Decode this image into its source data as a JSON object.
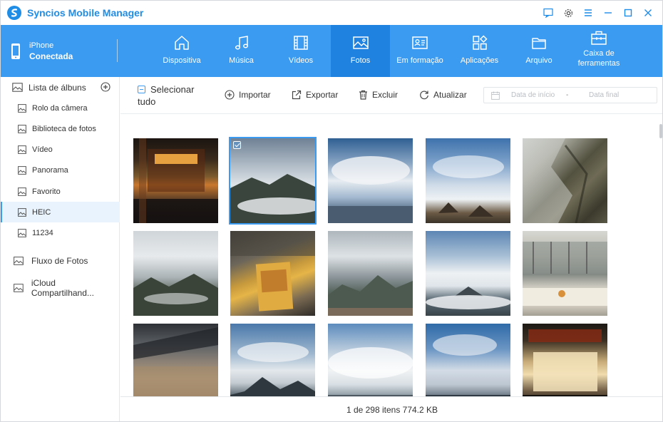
{
  "app": {
    "title": "Syncios Mobile Manager",
    "brand_color": "#1f8ce6",
    "nav_color": "#3b9bf0"
  },
  "window_controls": [
    "chat-icon",
    "gear-icon",
    "menu-icon",
    "minimize-icon",
    "maximize-icon",
    "close-icon"
  ],
  "device": {
    "name": "iPhone",
    "status": "Conectada"
  },
  "nav": {
    "tabs": [
      {
        "label": "Dispositiva",
        "icon": "home-icon"
      },
      {
        "label": "Música",
        "icon": "music-icon"
      },
      {
        "label": "Vídeos",
        "icon": "film-icon"
      },
      {
        "label": "Fotos",
        "icon": "image-icon",
        "active": true
      },
      {
        "label": "Em formação",
        "icon": "id-card-icon"
      },
      {
        "label": "Aplicações",
        "icon": "apps-icon"
      },
      {
        "label": "Arquivo",
        "icon": "folder-icon"
      },
      {
        "label": "Caixa de ferramentas",
        "icon": "toolbox-icon"
      }
    ]
  },
  "sidebar": {
    "album_list_label": "Lista de álbuns",
    "albums": [
      {
        "label": "Rolo da câmera"
      },
      {
        "label": "Biblioteca de fotos"
      },
      {
        "label": "Vídeo"
      },
      {
        "label": "Panorama"
      },
      {
        "label": "Favorito"
      },
      {
        "label": "HEIC",
        "active": true
      },
      {
        "label": "11234"
      }
    ],
    "photo_stream": "Fluxo de Fotos",
    "icloud_shared": "iCloud Compartilhand..."
  },
  "toolbar": {
    "select_all_1": "Selecionar",
    "select_all_2": "tudo",
    "import": "Importar",
    "export": "Exportar",
    "delete": "Excluir",
    "refresh": "Atualizar",
    "date_start": "Data de início",
    "date_sep": "-",
    "date_end": "Data final"
  },
  "photos": [
    {
      "name": "photo-night-gate",
      "selected": false
    },
    {
      "name": "photo-cloud-mountain",
      "selected": true
    },
    {
      "name": "photo-blue-sky",
      "selected": false
    },
    {
      "name": "photo-peaks-clouds",
      "selected": false
    },
    {
      "name": "photo-cliff",
      "selected": false
    },
    {
      "name": "photo-grey-mountain",
      "selected": false
    },
    {
      "name": "photo-ticket",
      "selected": false
    },
    {
      "name": "photo-mountain-ridge",
      "selected": false
    },
    {
      "name": "photo-sea-of-clouds",
      "selected": false
    },
    {
      "name": "photo-office",
      "selected": false
    },
    {
      "name": "photo-terracotta",
      "selected": false
    },
    {
      "name": "photo-sky-peak",
      "selected": false
    },
    {
      "name": "photo-white-clouds",
      "selected": false
    },
    {
      "name": "photo-blue-clouds",
      "selected": false
    },
    {
      "name": "photo-stage",
      "selected": false
    }
  ],
  "status": {
    "text": "1 de 298 itens 774.2 KB"
  }
}
